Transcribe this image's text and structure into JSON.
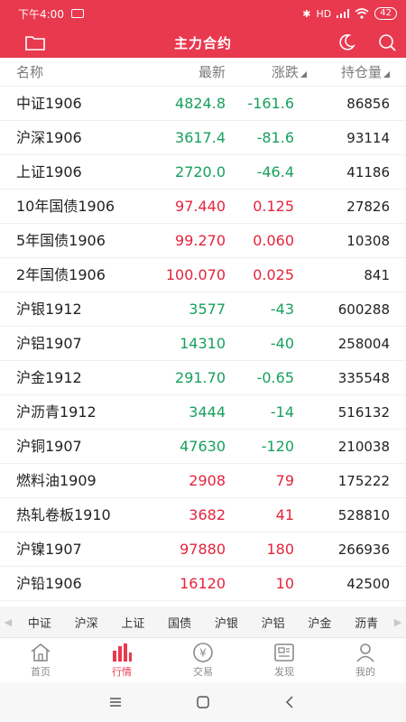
{
  "status": {
    "time": "下午4:00",
    "battery": "42",
    "signal_text": "HD"
  },
  "header": {
    "title": "主力合约"
  },
  "columns": {
    "name": "名称",
    "last": "最新",
    "change": "涨跌",
    "oi": "持仓量"
  },
  "rows": [
    {
      "name": "中证1906",
      "last": "4824.8",
      "change": "-161.6",
      "oi": "86856",
      "dir": "down"
    },
    {
      "name": "沪深1906",
      "last": "3617.4",
      "change": "-81.6",
      "oi": "93114",
      "dir": "down"
    },
    {
      "name": "上证1906",
      "last": "2720.0",
      "change": "-46.4",
      "oi": "41186",
      "dir": "down"
    },
    {
      "name": "10年国债1906",
      "last": "97.440",
      "change": "0.125",
      "oi": "27826",
      "dir": "up"
    },
    {
      "name": "5年国债1906",
      "last": "99.270",
      "change": "0.060",
      "oi": "10308",
      "dir": "up"
    },
    {
      "name": "2年国债1906",
      "last": "100.070",
      "change": "0.025",
      "oi": "841",
      "dir": "up"
    },
    {
      "name": "沪银1912",
      "last": "3577",
      "change": "-43",
      "oi": "600288",
      "dir": "down"
    },
    {
      "name": "沪铝1907",
      "last": "14310",
      "change": "-40",
      "oi": "258004",
      "dir": "down"
    },
    {
      "name": "沪金1912",
      "last": "291.70",
      "change": "-0.65",
      "oi": "335548",
      "dir": "down"
    },
    {
      "name": "沪沥青1912",
      "last": "3444",
      "change": "-14",
      "oi": "516132",
      "dir": "down"
    },
    {
      "name": "沪铜1907",
      "last": "47630",
      "change": "-120",
      "oi": "210038",
      "dir": "down"
    },
    {
      "name": "燃料油1909",
      "last": "2908",
      "change": "79",
      "oi": "175222",
      "dir": "up"
    },
    {
      "name": "热轧卷板1910",
      "last": "3682",
      "change": "41",
      "oi": "528810",
      "dir": "up"
    },
    {
      "name": "沪镍1907",
      "last": "97880",
      "change": "180",
      "oi": "266936",
      "dir": "up"
    },
    {
      "name": "沪铅1906",
      "last": "16120",
      "change": "10",
      "oi": "42500",
      "dir": "up"
    }
  ],
  "quick_tabs": [
    "中证",
    "沪深",
    "上证",
    "国债",
    "沪银",
    "沪铝",
    "沪金",
    "沥青"
  ],
  "nav": [
    {
      "label": "首页",
      "icon": "home-icon",
      "active": false
    },
    {
      "label": "行情",
      "icon": "market-icon",
      "active": true
    },
    {
      "label": "交易",
      "icon": "yuan-icon",
      "active": false
    },
    {
      "label": "发现",
      "icon": "discover-icon",
      "active": false
    },
    {
      "label": "我的",
      "icon": "profile-icon",
      "active": false
    }
  ],
  "colors": {
    "brand": "#e8394f",
    "up": "#e4243d",
    "down": "#17a05d"
  }
}
